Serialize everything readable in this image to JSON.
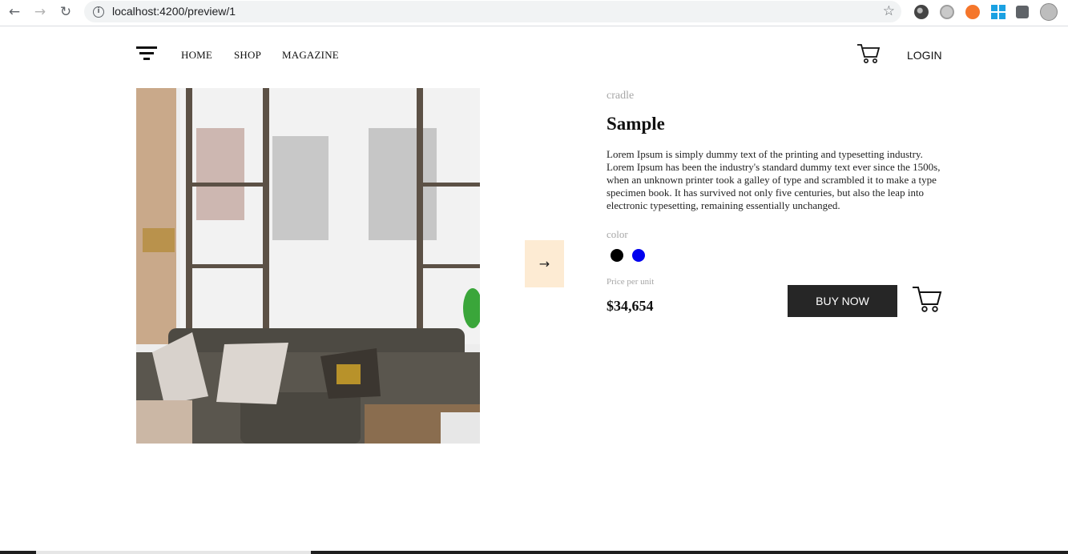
{
  "browser": {
    "url": "localhost:4200/preview/1",
    "back_icon": "arrow-left-icon",
    "forward_icon": "arrow-right-icon",
    "reload_icon": "reload-icon",
    "info_icon": "info-icon",
    "bookmark_icon": "star-icon",
    "extensions": [
      "dark-circle-extension-icon",
      "grey-globe-extension-icon",
      "orange-extension-icon",
      "windows-extension-icon",
      "puzzle-icon",
      "profile-avatar-icon"
    ]
  },
  "header": {
    "menu_icon": "hamburger-icon",
    "nav": [
      "HOME",
      "SHOP",
      "MAGAZINE"
    ],
    "cart_icon": "cart-icon",
    "login": "LOGIN"
  },
  "product": {
    "category": "cradle",
    "title": "Sample",
    "description": "Lorem Ipsum is simply dummy text of the printing and typesetting industry. Lorem Ipsum has been the industry's standard dummy text ever since the 1500s, when an unknown printer took a galley of type and scrambled it to make a type specimen book. It has survived not only five centuries, but also the leap into electronic typesetting, remaining essentially unchanged.",
    "color_label": "color",
    "colors": [
      "#000000",
      "#0000ee"
    ],
    "price_label": "Price per unit",
    "price": "$34,654",
    "buy_now": "BUY NOW",
    "image_icon": "living-room-photo",
    "next_icon": "arrow-right-icon"
  }
}
